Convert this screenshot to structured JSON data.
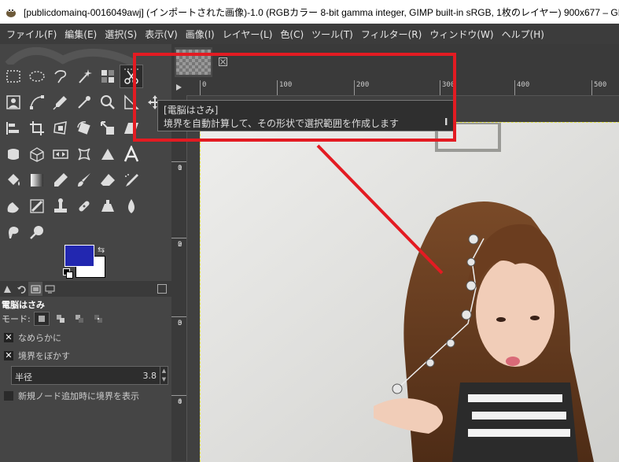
{
  "window": {
    "title": "[publicdomainq-0016049awj] (インポートされた画像)-1.0 (RGBカラー 8-bit gamma integer, GIMP built-in sRGB, 1枚のレイヤー) 900x677 – GIMP"
  },
  "menu": [
    {
      "label": "ファイル(F)",
      "name": "menu-file"
    },
    {
      "label": "編集(E)",
      "name": "menu-edit"
    },
    {
      "label": "選択(S)",
      "name": "menu-select"
    },
    {
      "label": "表示(V)",
      "name": "menu-view"
    },
    {
      "label": "画像(I)",
      "name": "menu-image"
    },
    {
      "label": "レイヤー(L)",
      "name": "menu-layer"
    },
    {
      "label": "色(C)",
      "name": "menu-colors"
    },
    {
      "label": "ツール(T)",
      "name": "menu-tools"
    },
    {
      "label": "フィルター(R)",
      "name": "menu-filters"
    },
    {
      "label": "ウィンドウ(W)",
      "name": "menu-windows"
    },
    {
      "label": "ヘルプ(H)",
      "name": "menu-help"
    }
  ],
  "colors": {
    "foreground": "#2227b0",
    "background": "#ffffff",
    "highlight": "#e31b22"
  },
  "tool_options": {
    "title": "電脳はさみ",
    "mode_label": "モード:",
    "smooth_label": "なめらかに",
    "feather_label": "境界をぼかす",
    "radius_label": "半径",
    "radius_value": "3.8",
    "show_nodes_label": "新規ノード追加時に境界を表示"
  },
  "ruler": {
    "h_labels": [
      "0",
      "100",
      "200",
      "300",
      "400",
      "500"
    ],
    "v_labels": [
      "1",
      "0",
      "0",
      "2",
      "0",
      "0",
      "3",
      "0",
      "0",
      "4",
      "0"
    ]
  },
  "tooltip": {
    "title": "[電脳はさみ]",
    "description": "境界を自動計算して、その形状で選択範囲を作成します",
    "shortcut": "I"
  }
}
